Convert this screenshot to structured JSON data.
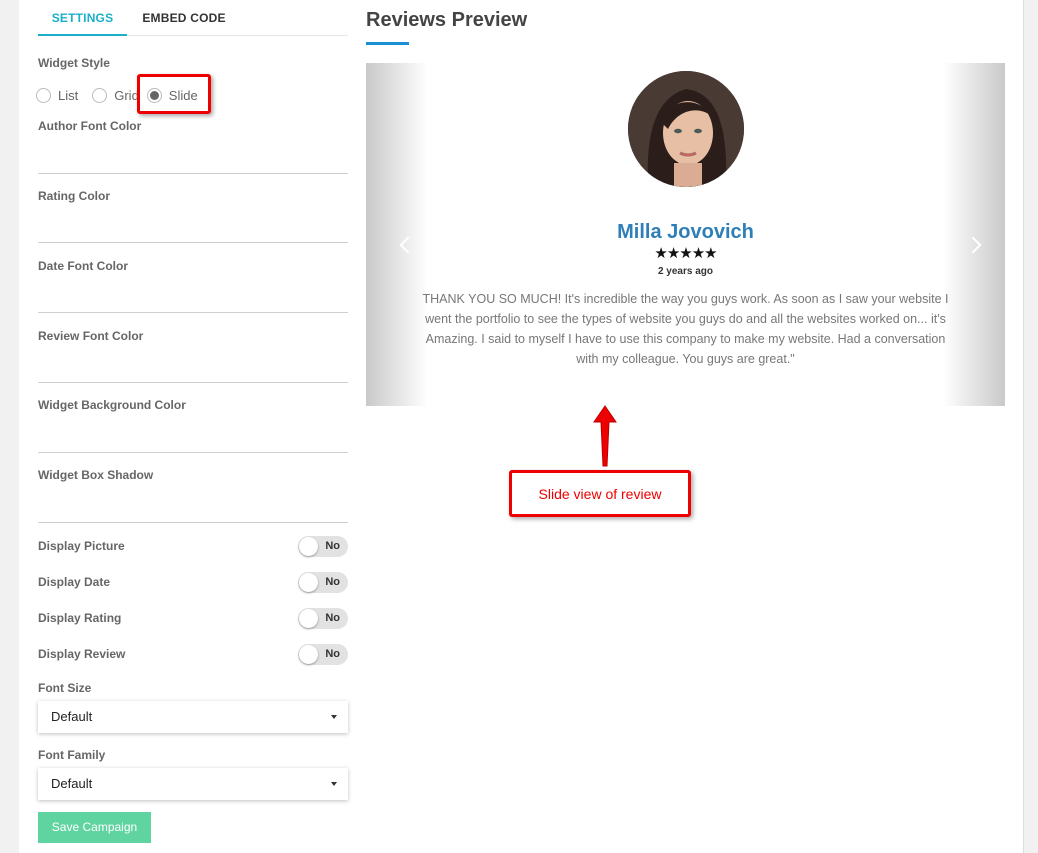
{
  "tabs": {
    "settings": "SETTINGS",
    "embed": "EMBED CODE"
  },
  "widget_style": {
    "label": "Widget Style",
    "options": [
      "List",
      "Grid",
      "Slide"
    ],
    "selected": "Slide"
  },
  "color_fields": {
    "author": "Author Font Color",
    "rating": "Rating Color",
    "date": "Date Font Color",
    "review": "Review Font Color",
    "background": "Widget Background Color",
    "shadow": "Widget Box Shadow"
  },
  "toggles": {
    "picture": {
      "label": "Display Picture",
      "value": "No"
    },
    "date": {
      "label": "Display Date",
      "value": "No"
    },
    "rating": {
      "label": "Display Rating",
      "value": "No"
    },
    "review": {
      "label": "Display Review",
      "value": "No"
    }
  },
  "font_size": {
    "label": "Font Size",
    "value": "Default"
  },
  "font_family": {
    "label": "Font Family",
    "value": "Default"
  },
  "save_button": "Save Campaign",
  "preview": {
    "title": "Reviews Preview",
    "author": "Milla Jovovich",
    "stars": "★★★★★",
    "rating": 5,
    "date": "2 years ago",
    "review_text": "THANK YOU SO MUCH! It's incredible the way you guys work. As soon as I saw your website I went the portfolio to see the types of website you guys do and all the websites worked on... it's Amazing. I said to myself I have to use this company to make my website. Had a conversation with my colleague. You guys are great.\""
  },
  "annotation": {
    "text": "Slide view of review"
  },
  "colors": {
    "accent": "#1ab0c9",
    "save_button": "#5fd4a0",
    "author_name": "#2e7fb8",
    "annotation_red": "#e00000"
  }
}
